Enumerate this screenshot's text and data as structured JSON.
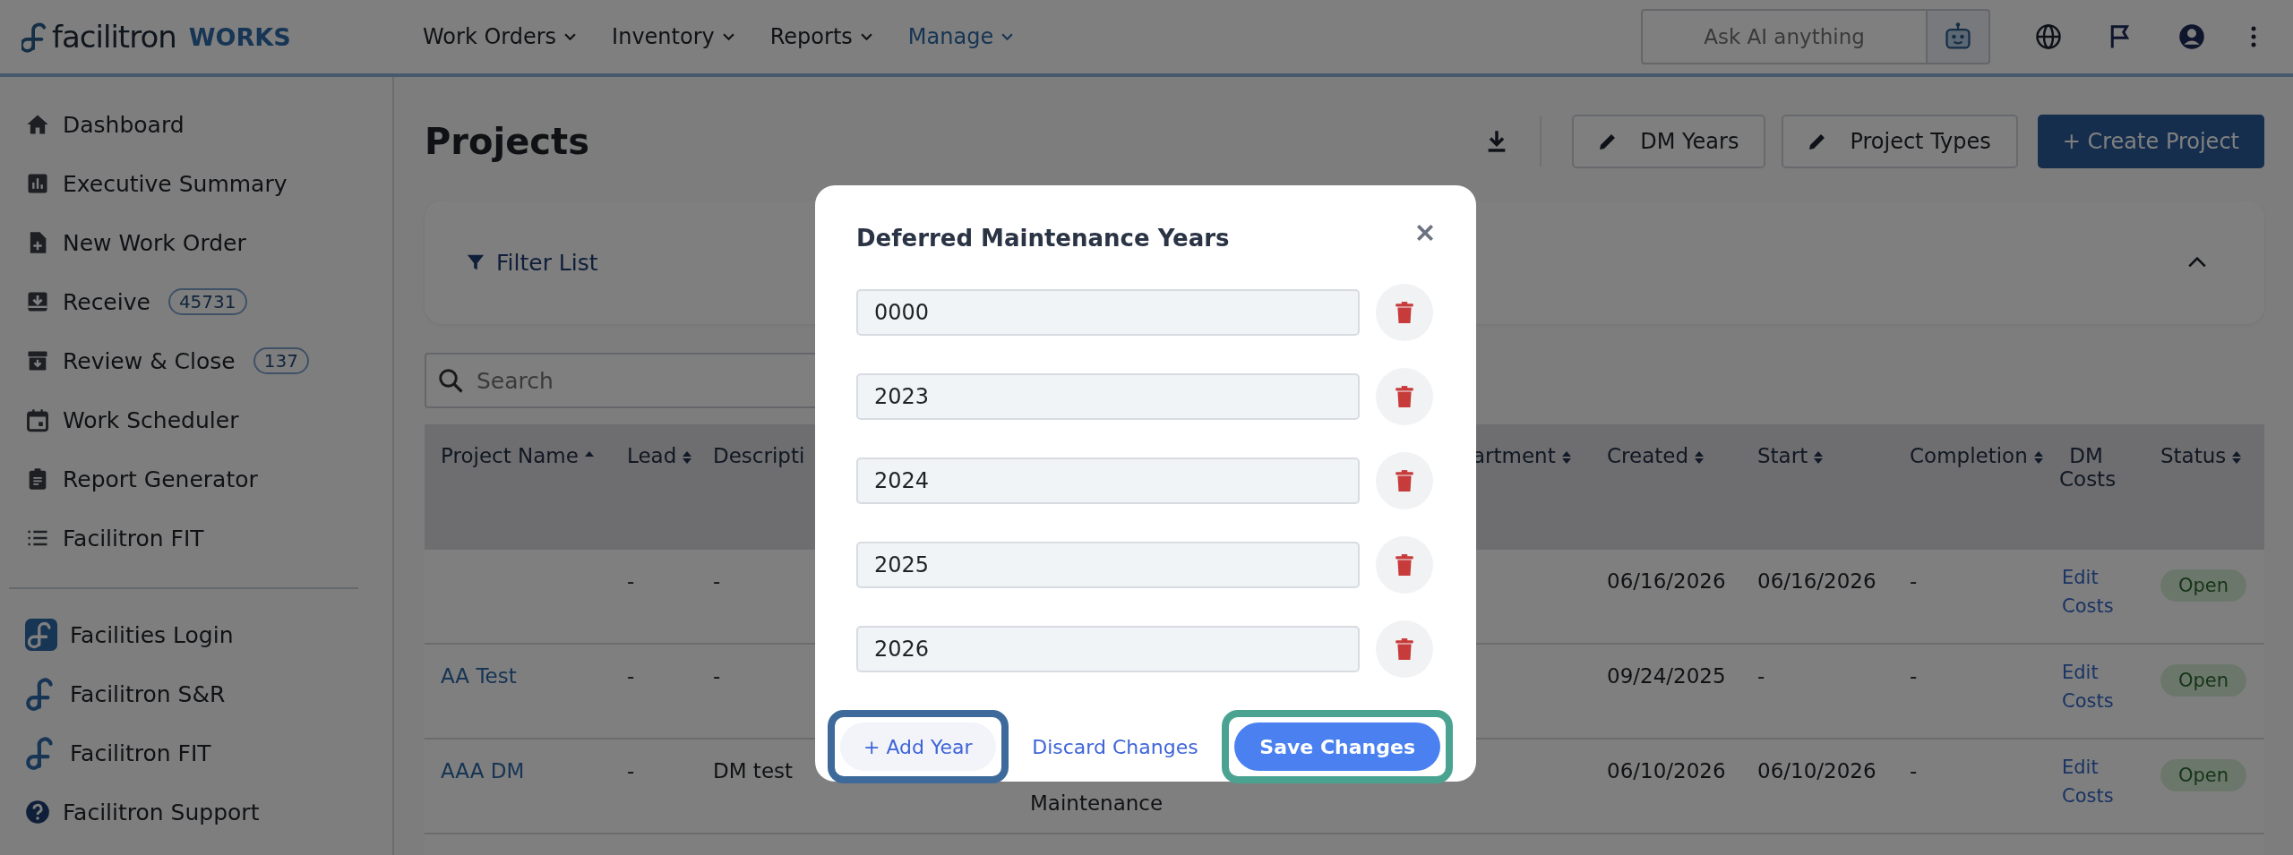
{
  "navbar": {
    "logo": {
      "name": "facilitron",
      "product": "WORKS"
    },
    "menus": [
      {
        "label": "Work Orders",
        "selected": false
      },
      {
        "label": "Inventory",
        "selected": false
      },
      {
        "label": "Reports",
        "selected": false
      },
      {
        "label": "Manage",
        "selected": true
      }
    ],
    "ai_search": {
      "placeholder": "Ask AI anything"
    }
  },
  "sidebar": {
    "items": [
      {
        "label": "Dashboard"
      },
      {
        "label": "Executive Summary"
      },
      {
        "label": "New Work Order"
      },
      {
        "label": "Receive",
        "badge": "45731"
      },
      {
        "label": "Review & Close",
        "badge": "137"
      },
      {
        "label": "Work Scheduler"
      },
      {
        "label": "Report Generator"
      },
      {
        "label": "Facilitron FIT"
      }
    ],
    "links": [
      {
        "label": "Facilities Login"
      },
      {
        "label": "Facilitron S&R"
      },
      {
        "label": "Facilitron FIT"
      },
      {
        "label": "Facilitron Support"
      }
    ]
  },
  "page": {
    "title": "Projects",
    "toolbar": [
      {
        "label": "DM Years",
        "kind": "outline"
      },
      {
        "label": "Project Types",
        "kind": "outline"
      },
      {
        "label": "+ Create Project",
        "kind": "primary"
      }
    ],
    "filter": {
      "label": "Filter List",
      "expanded": true
    },
    "search": {
      "placeholder": "Search"
    }
  },
  "table": {
    "columns": [
      {
        "label": "Project Name",
        "sortable": true,
        "sorted": true,
        "kind": "link"
      },
      {
        "label": "Lead",
        "sortable": true,
        "sorted": false,
        "kind": "text"
      },
      {
        "label": "Descripti",
        "kind": "text"
      },
      {
        "label": "artment",
        "sortable": true,
        "sorted": false
      },
      {
        "label": "Created",
        "sortable": true,
        "sorted": false,
        "kind": "text"
      },
      {
        "label": "Start",
        "sortable": true,
        "sorted": false,
        "kind": "text"
      },
      {
        "label": "Completion",
        "sortable": true,
        "sorted": false,
        "kind": "text"
      },
      {
        "label": "DM Costs",
        "kind": "link"
      },
      {
        "label": "Status",
        "sortable": true,
        "sorted": false,
        "kind": "status"
      }
    ],
    "rows": [
      {
        "cells": [
          null,
          "-",
          "-",
          null,
          "06/16/2026",
          "06/16/2026",
          "-",
          "Edit Costs",
          "Open"
        ]
      },
      {
        "cells": [
          "AA Test",
          "-",
          "-",
          null,
          "09/24/2025",
          "-",
          "-",
          "Edit Costs",
          "Open"
        ]
      },
      {
        "cells": [
          "AAA DM",
          "-",
          "DM test",
          null,
          "06/10/2026",
          "06/10/2026",
          "-",
          "Edit Costs",
          "Open"
        ],
        "project_type": "Maintenance"
      }
    ]
  },
  "modal": {
    "title": "Deferred Maintenance Years",
    "years": [
      "0000",
      "2023",
      "2024",
      "2025",
      "2026"
    ],
    "buttons": [
      {
        "label": "+ Add Year",
        "kind": "secondary",
        "highlighted": true
      },
      {
        "label": "Discard Changes",
        "kind": "link",
        "highlighted": false
      },
      {
        "label": "Save Changes",
        "kind": "primary",
        "highlighted": true
      }
    ]
  }
}
